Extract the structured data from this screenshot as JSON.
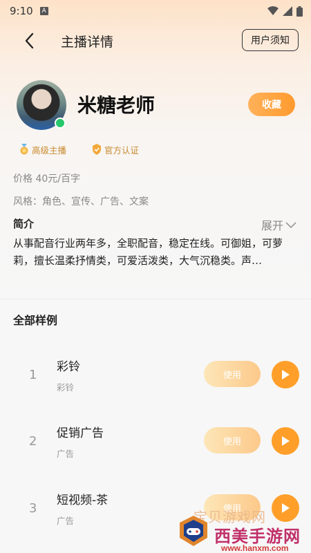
{
  "status_bar": {
    "time": "9:10",
    "notification_icon": "A"
  },
  "header": {
    "back_icon": "back-chevron-icon",
    "title": "主播详情",
    "notice_label": "用户须知"
  },
  "profile": {
    "name": "米糖老师",
    "favorite_label": "收藏",
    "online": true,
    "badges": [
      "高级主播",
      "官方认证"
    ],
    "price": "价格 40元/百字",
    "style": "风格：角色、宣传、广告、文案"
  },
  "intro": {
    "title": "简介",
    "expand_label": "展开",
    "text": "从事配音行业两年多，全职配音，稳定在线。可御姐，可萝莉，擅长温柔抒情类，可爱活泼类，大气沉稳类。声…"
  },
  "samples_section": {
    "title": "全部样例",
    "use_label": "使用",
    "items": [
      {
        "index": "1",
        "title": "彩铃",
        "category": "彩铃"
      },
      {
        "index": "2",
        "title": "促销广告",
        "category": "广告"
      },
      {
        "index": "3",
        "title": "短视频-茶",
        "category": "广告"
      }
    ]
  },
  "watermark": {
    "top": "宝贝游戏网",
    "main": "西美手游网",
    "url": "www.hanxm.com"
  },
  "colors": {
    "accent": "#ff9f2a",
    "badge": "#c98a2f",
    "online": "#27c76b"
  }
}
